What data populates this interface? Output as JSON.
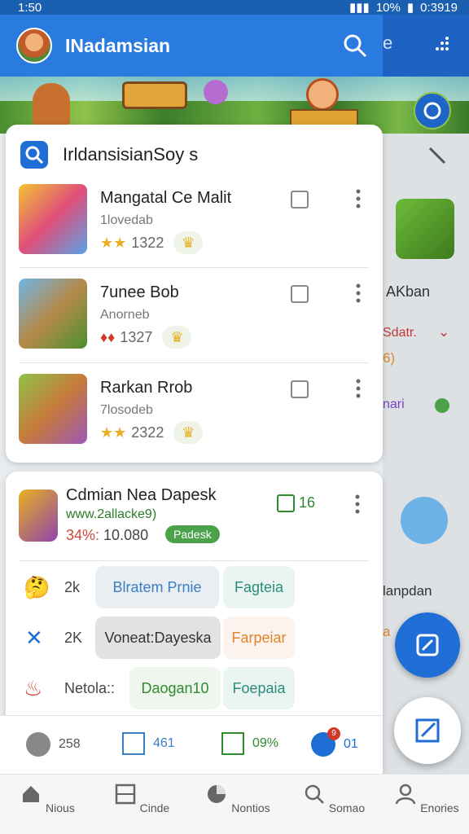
{
  "status_bar": {
    "time": "1:50",
    "battery": "10%",
    "clock_right": "0:3919"
  },
  "app": {
    "title": "INadamsian",
    "back_partial": "e"
  },
  "card1": {
    "title": "IrldansisianSoy s",
    "rows": [
      {
        "title": "Mangatal Ce Malit",
        "sub": "1lovedab",
        "count": "1322"
      },
      {
        "title": "7unee Bob",
        "sub": "Anorneb",
        "count": "1327"
      },
      {
        "title": "Rarkan Rrob",
        "sub": "7losodeb",
        "count": "2322"
      }
    ]
  },
  "side": {
    "label1": "AKban",
    "label2": "Sdatr.",
    "label3": "6)",
    "label4": "nari",
    "label5": "lanpdan"
  },
  "card2": {
    "title": "Cdmian Nea Dapesk",
    "sub": "www.2allacke9)",
    "stats_pct": "34%:",
    "stats_num": "10.080",
    "status": "Padesk",
    "edit_count": "16",
    "tags": [
      {
        "label": "2k",
        "a": "Blratem Prnie",
        "b": "Fagteia"
      },
      {
        "label": "2K",
        "a": "Voneat:Dayeska",
        "b": "Farpeiar"
      },
      {
        "label": "Netola::",
        "a": "Daogan10",
        "b": "Foepaia"
      }
    ]
  },
  "footer": {
    "a": "258",
    "b": "461",
    "c": "09%",
    "d": "01",
    "badge": "9"
  },
  "nav": {
    "home": "Nious",
    "circle": "Cinde",
    "monitor": "Nontios",
    "search": "Somao",
    "profile": "Enories"
  }
}
